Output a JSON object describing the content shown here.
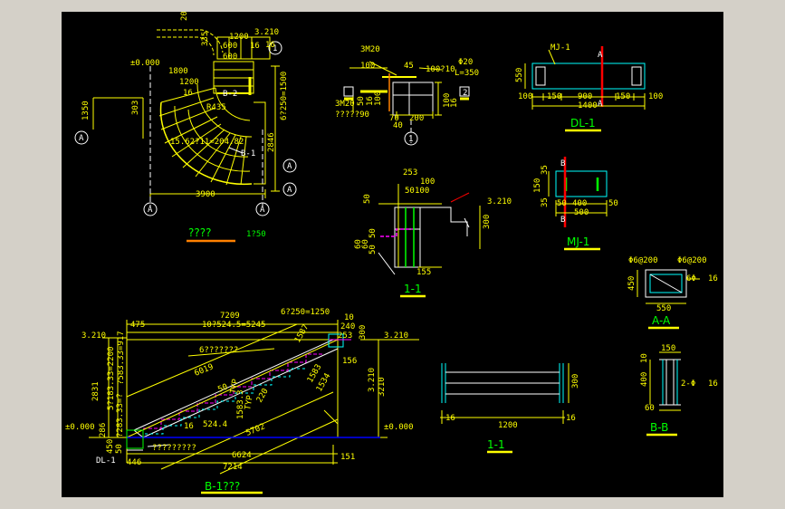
{
  "colors": {
    "background": "#000000",
    "frame": "#d4d0c8",
    "yellow": "#ffff00",
    "green": "#00ff00",
    "white": "#ffffff",
    "cyan": "#00ffff",
    "magenta": "#ff00ff",
    "red": "#ff0000",
    "blue": "#0000ff",
    "orange": "#ff8000"
  },
  "plan": {
    "title": "????",
    "scale": "1?50",
    "dims": [
      "1200",
      "3.210",
      "600",
      "16",
      "600",
      "±0.000",
      "1800",
      "1200",
      "16",
      "1350",
      "303",
      "6?250=1500",
      "2846",
      "3900",
      "15.62?11=204.82",
      "R435",
      "335",
      "20",
      "16"
    ],
    "labels": [
      "B-2",
      "B-1",
      "A",
      "A",
      "A",
      "A",
      "A",
      "1"
    ]
  },
  "detail1": {
    "labels": [
      "3M20",
      "3M20",
      "?????90",
      "2",
      "1"
    ],
    "dims": [
      "100",
      "45",
      "Φ20",
      "100?10",
      "L=350",
      "50",
      "16",
      "100",
      "70",
      "200",
      "100",
      "16",
      "40"
    ]
  },
  "dl1": {
    "title": "DL-1",
    "tag": "MJ-1",
    "dims": [
      "550",
      "100",
      "150",
      "900",
      "150",
      "100",
      "1400"
    ],
    "cut": "A"
  },
  "mj1": {
    "title": "MJ-1",
    "dims": [
      "35",
      "35",
      "150",
      "400",
      "50",
      "50",
      "500"
    ],
    "cut": "B"
  },
  "aa": {
    "title": "A-A",
    "dims": [
      "Φ6@200",
      "Φ6@200",
      "6Φ",
      "16",
      "450",
      "550"
    ]
  },
  "sec11a": {
    "title": "1-1",
    "dims": [
      "253",
      "100",
      "50",
      "100",
      "50",
      "3.210",
      "300",
      "60",
      "60",
      "50",
      "50",
      "155"
    ]
  },
  "bb": {
    "title": "B-B",
    "dims": [
      "150",
      "10",
      "400",
      "2-Φ",
      "16",
      "60"
    ]
  },
  "sec11b": {
    "title": "1-1",
    "dims": [
      "1200",
      "16",
      "16",
      "300"
    ]
  },
  "b1": {
    "title": "B-1???",
    "dims": [
      "7209",
      "6?250=1250",
      "475",
      "10?524.5=5245",
      "10",
      "240",
      "300",
      "253",
      "3.210",
      "3.210",
      "3.210",
      "6???????",
      "?583.33=917",
      "2831",
      "5?183.33=2200",
      "?283.33=?",
      "286",
      "±0.000",
      "±0.000",
      "450",
      "50",
      "6019",
      "5702",
      "524.4",
      "6624",
      "7214",
      "151",
      "446",
      "1587",
      "1583",
      "1534",
      "1583.3",
      "156",
      "50",
      "3210",
      "16",
      "220",
      "TYP",
      "TYP",
      "?????????"
    ],
    "labels": [
      "DL-1",
      "???????"
    ]
  }
}
